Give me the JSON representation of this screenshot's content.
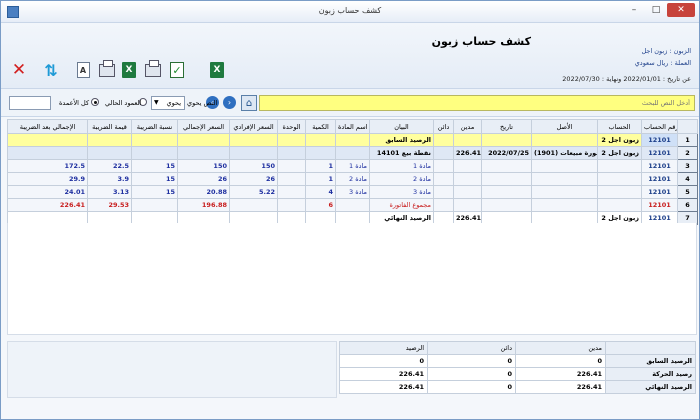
{
  "window": {
    "title": "كشف حساب زبون",
    "controls": {
      "minimize": "–",
      "maximize": "□",
      "close": "✕"
    }
  },
  "header": {
    "report_title": "كشف حساب زبون",
    "customer_line": "الزبون : زبون اجل",
    "currency_line": "العملة : ريال سعودي",
    "date_range": "عن تاريخ : 2022/01/01 ونهاية : 2022/07/30"
  },
  "toolbar": {
    "icons": [
      "close-icon",
      "refresh-icon",
      "font-icon",
      "print-icon",
      "excel-icon",
      "print-preview-icon",
      "check-icon",
      "excel-export-icon"
    ],
    "font_glyph": "A",
    "excel_glyph": "X",
    "check_glyph": "✓"
  },
  "search": {
    "placeholder": "أدخل النص للبحث",
    "text_type_label": "النص يحوي",
    "select_value": "يحوي",
    "radio_current_column": "العمود الحالي",
    "radio_all_columns": "كل الأعمدة",
    "selected_radio": "all_columns"
  },
  "grid": {
    "columns": [
      "رقم الحساب",
      "الحساب",
      "الأصل",
      "تاريخ",
      "مدين",
      "دائن",
      "البيان",
      "اسم المادة",
      "الكمية",
      "الوحدة",
      "السعر الإفرادي",
      "السعر الإجمالي",
      "نسبة الضريبة",
      "قيمة الضريبة",
      "الإجمالي بعد الضريبة"
    ],
    "rows": [
      {
        "n": "1",
        "acct": "12101",
        "account": "زبون اجل 2",
        "origin": "",
        "date": "",
        "debit": "",
        "credit": "",
        "statement": "الرصيد السابق",
        "item": "",
        "qty": "",
        "unit": "",
        "unit_price": "",
        "total_price": "",
        "tax_pct": "",
        "tax_val": "",
        "total_after_tax": "",
        "style": "yellow"
      },
      {
        "n": "2",
        "acct": "12101",
        "account": "زبون اجل 2",
        "origin": "فاتورة مبيعات (1901)",
        "date": "2022/07/25",
        "debit": "226.41",
        "credit": "",
        "statement": "نقطة بيع 14101",
        "item": "",
        "qty": "",
        "unit": "",
        "unit_price": "",
        "total_price": "",
        "tax_pct": "",
        "tax_val": "",
        "total_after_tax": "",
        "style": "blue"
      },
      {
        "n": "3",
        "acct": "12101",
        "account": "",
        "origin": "",
        "date": "",
        "debit": "",
        "credit": "",
        "statement": "مادة 1",
        "item": "مادة 1",
        "qty": "1",
        "unit": "",
        "unit_price": "150",
        "total_price": "150",
        "tax_pct": "15",
        "tax_val": "22.5",
        "total_after_tax": "172.5",
        "style": "light"
      },
      {
        "n": "4",
        "acct": "12101",
        "account": "",
        "origin": "",
        "date": "",
        "debit": "",
        "credit": "",
        "statement": "مادة 2",
        "item": "مادة 2",
        "qty": "1",
        "unit": "",
        "unit_price": "26",
        "total_price": "26",
        "tax_pct": "15",
        "tax_val": "3.9",
        "total_after_tax": "29.9",
        "style": "light"
      },
      {
        "n": "5",
        "acct": "12101",
        "account": "",
        "origin": "",
        "date": "",
        "debit": "",
        "credit": "",
        "statement": "مادة 3",
        "item": "مادة 3",
        "qty": "4",
        "unit": "",
        "unit_price": "5.22",
        "total_price": "20.88",
        "tax_pct": "15",
        "tax_val": "3.13",
        "total_after_tax": "24.01",
        "style": "light"
      },
      {
        "n": "6",
        "acct": "12101",
        "account": "",
        "origin": "",
        "date": "",
        "debit": "",
        "credit": "",
        "statement": "مجموع الفاتورة",
        "item": "",
        "qty": "6",
        "unit": "",
        "unit_price": "",
        "total_price": "196.88",
        "tax_pct": "",
        "tax_val": "29.53",
        "total_after_tax": "226.41",
        "style": "light-total"
      },
      {
        "n": "7",
        "acct": "12101",
        "account": "زبون اجل 2",
        "origin": "",
        "date": "",
        "debit": "226.41",
        "credit": "",
        "statement": "الرصيد النهائي",
        "item": "",
        "qty": "",
        "unit": "",
        "unit_price": "",
        "total_price": "",
        "tax_pct": "",
        "tax_val": "",
        "total_after_tax": "",
        "style": "white"
      }
    ]
  },
  "summary": {
    "headers": [
      "مدين",
      "دائن",
      "الرصيد"
    ],
    "rows": [
      {
        "label": "الرصيد السابق",
        "debit": "0",
        "credit": "0",
        "balance": "0"
      },
      {
        "label": "رصيد الحركة",
        "debit": "226.41",
        "credit": "0",
        "balance": "226.41"
      },
      {
        "label": "الرصيد النهائي",
        "debit": "226.41",
        "credit": "0",
        "balance": "226.41"
      }
    ]
  }
}
